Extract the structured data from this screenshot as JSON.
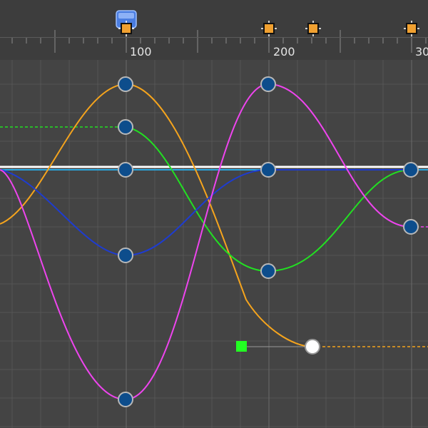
{
  "ruler": {
    "labels": [
      "100",
      "200",
      "30"
    ]
  },
  "timeline": {
    "playhead_label": "",
    "keyframe_count": 4
  },
  "curves": [
    {
      "name": "orange",
      "color": "#f5a41d"
    },
    {
      "name": "green",
      "color": "#22e022"
    },
    {
      "name": "blue",
      "color": "#1e3cd0"
    },
    {
      "name": "magenta",
      "color": "#ee44ee"
    },
    {
      "name": "cyan",
      "color": "#2aa9e0"
    },
    {
      "name": "white",
      "color": "#ffffff"
    }
  ],
  "colors": {
    "background": "#444444",
    "grid": "#555555",
    "key_fill": "#0d4d8c",
    "key_stroke": "#b8b8b8",
    "tangent_handle": "#22ff22"
  }
}
